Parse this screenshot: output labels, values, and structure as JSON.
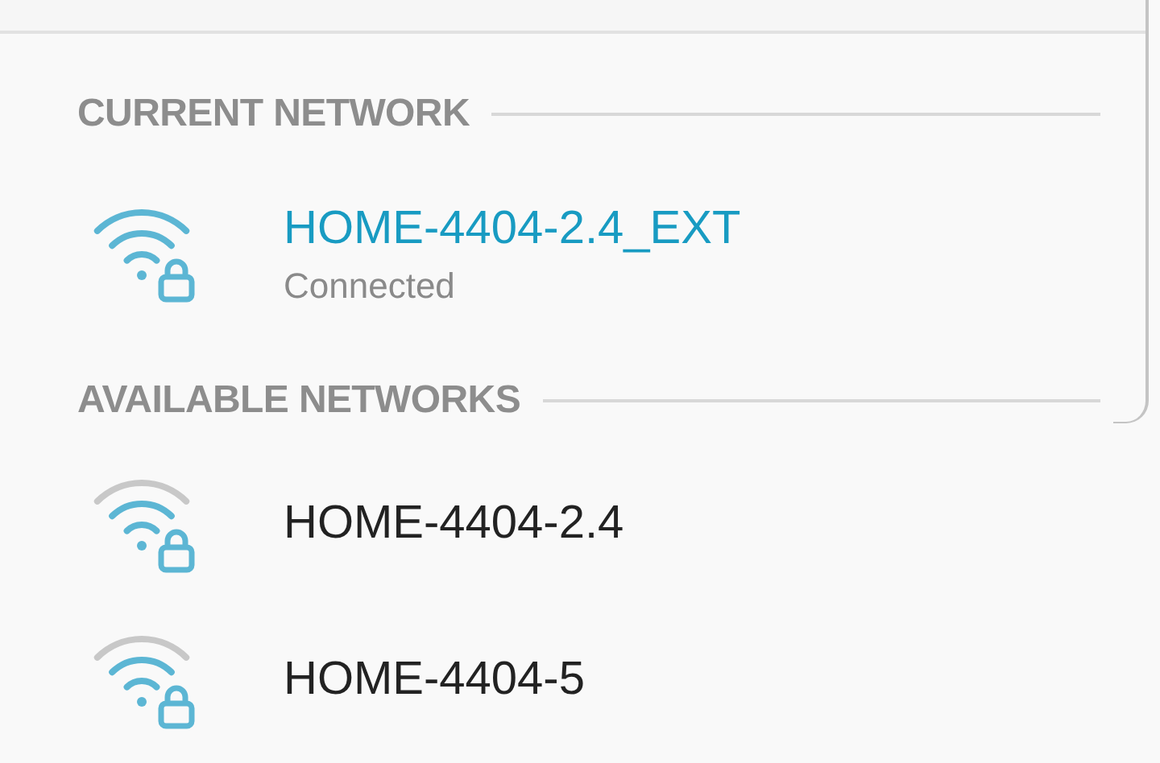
{
  "sections": [
    {
      "header": "CURRENT NETWORK",
      "networks": [
        {
          "name": "HOME-4404-2.4_EXT",
          "status": "Connected",
          "connected": true,
          "strong_signal": true,
          "locked": true
        }
      ]
    },
    {
      "header": "AVAILABLE NETWORKS",
      "networks": [
        {
          "name": "HOME-4404-2.4",
          "connected": false,
          "strong_signal": false,
          "locked": true
        },
        {
          "name": "HOME-4404-5",
          "connected": false,
          "strong_signal": false,
          "locked": true
        }
      ]
    }
  ]
}
